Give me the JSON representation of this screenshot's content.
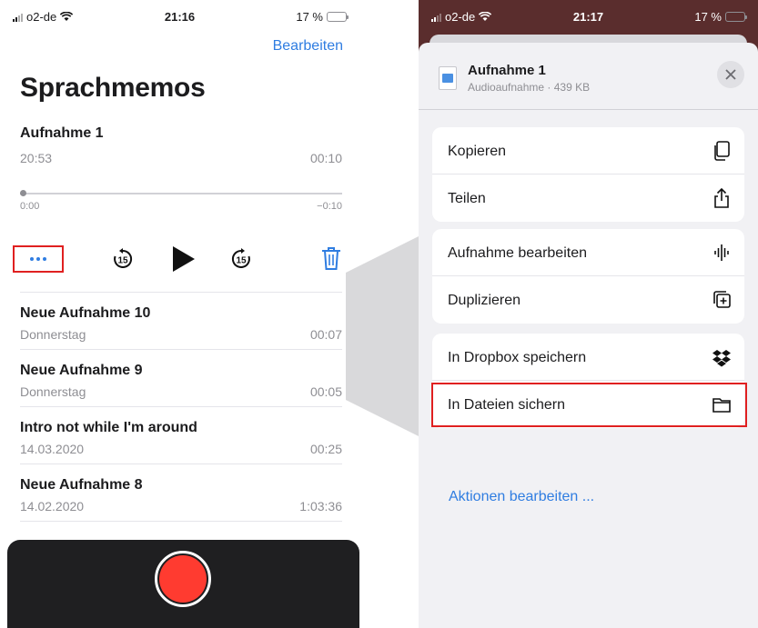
{
  "left_phone": {
    "status": {
      "carrier": "o2-de",
      "time": "21:16",
      "battery": "17 %"
    },
    "edit_label": "Bearbeiten",
    "title": "Sprachmemos",
    "current": {
      "name": "Aufnahme 1",
      "date": "20:53",
      "duration": "00:10",
      "elapsed": "0:00",
      "remaining": "−0:10",
      "progress": 0
    },
    "recordings": [
      {
        "name": "Neue Aufnahme 10",
        "date": "Donnerstag",
        "duration": "00:07"
      },
      {
        "name": "Neue Aufnahme 9",
        "date": "Donnerstag",
        "duration": "00:05"
      },
      {
        "name": "Intro not while I'm around",
        "date": "14.03.2020",
        "duration": "00:25"
      },
      {
        "name": "Neue Aufnahme 8",
        "date": "14.02.2020",
        "duration": "1:03:36"
      }
    ],
    "skip_seconds": "15"
  },
  "right_phone": {
    "status": {
      "carrier": "o2-de",
      "time": "21:17",
      "battery": "17 %"
    },
    "file": {
      "title": "Aufnahme 1",
      "subtitle": "Audioaufnahme · 439 KB"
    },
    "groups": [
      [
        {
          "label": "Kopieren",
          "icon": "copy-icon"
        },
        {
          "label": "Teilen",
          "icon": "share-icon"
        }
      ],
      [
        {
          "label": "Aufnahme bearbeiten",
          "icon": "waveform-icon"
        },
        {
          "label": "Duplizieren",
          "icon": "duplicate-icon"
        }
      ],
      [
        {
          "label": "In Dropbox speichern",
          "icon": "dropbox-icon"
        },
        {
          "label": "In Dateien sichern",
          "icon": "folder-icon"
        }
      ]
    ],
    "edit_actions": "Aktionen bearbeiten ..."
  },
  "colors": {
    "accent": "#2f7de1",
    "record": "#ff3b30",
    "highlight": "#e02020"
  }
}
